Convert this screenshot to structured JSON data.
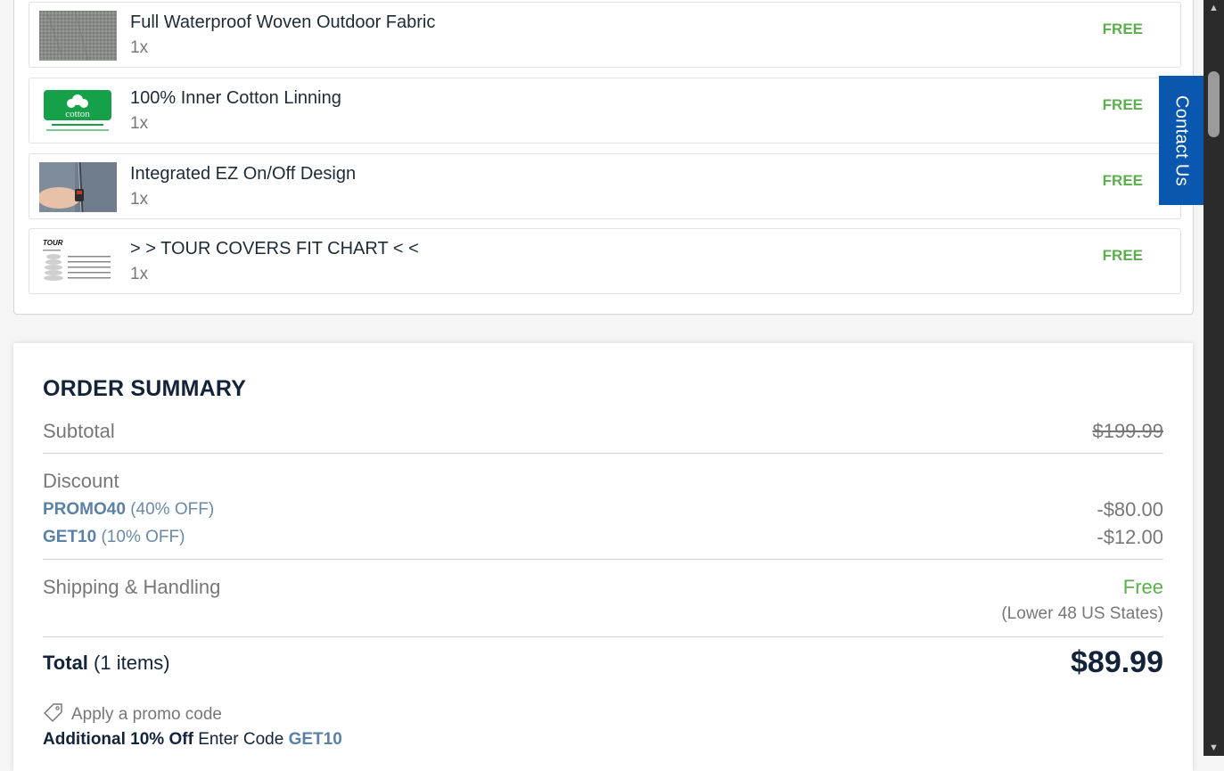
{
  "items": [
    {
      "name": "Full Waterproof Woven Outdoor Fabric",
      "qty": "1x",
      "price": "FREE",
      "thumb": "fabric-swatch"
    },
    {
      "name": "100% Inner Cotton Linning",
      "qty": "1x",
      "price": "FREE",
      "thumb": "cotton-logo"
    },
    {
      "name": "Integrated EZ On/Off Design",
      "qty": "1x",
      "price": "FREE",
      "thumb": "zipper-photo"
    },
    {
      "name": "> > TOUR COVERS FIT CHART < <",
      "qty": "1x",
      "price": "FREE",
      "thumb": "fit-chart"
    }
  ],
  "cotton_logo_text": "cotton",
  "fit_chart_logo_text": "TOUR",
  "summary": {
    "title": "ORDER SUMMARY",
    "subtotal_label": "Subtotal",
    "subtotal_value": "$199.99",
    "discount_label": "Discount",
    "discounts": [
      {
        "code": "PROMO40",
        "desc": "(40% OFF)",
        "amount": "-$80.00"
      },
      {
        "code": "GET10",
        "desc": "(10% OFF)",
        "amount": "-$12.00"
      }
    ],
    "shipping_label": "Shipping & Handling",
    "shipping_value": "Free",
    "shipping_note": "(Lower 48 US States)",
    "total_label": "Total",
    "total_count": "(1 items)",
    "total_value": "$89.99",
    "promo_link": "Apply a promo code",
    "additional_bold": "Additional 10% Off",
    "additional_text": "Enter Code",
    "additional_code": "GET10"
  },
  "contact_tab": "Contact Us",
  "colors": {
    "free_green": "#5cae4e",
    "navy": "#13243a",
    "code_blue": "#5a81a8",
    "contact_blue": "#0a57b0"
  }
}
